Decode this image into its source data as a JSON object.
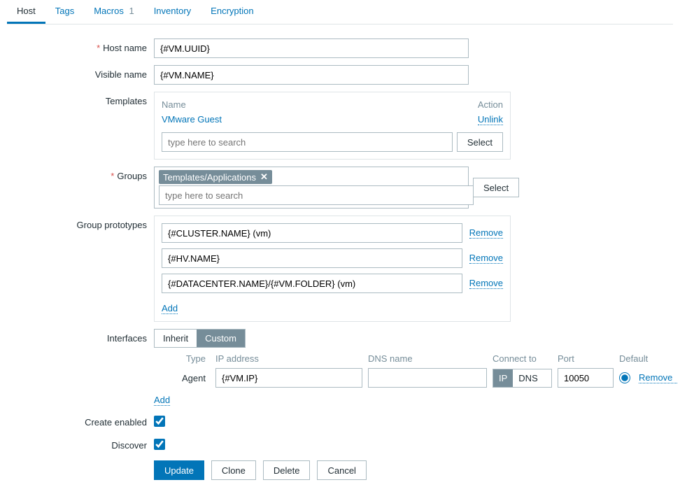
{
  "tabs": {
    "host": "Host",
    "tags": "Tags",
    "macros": "Macros",
    "macros_count": "1",
    "inventory": "Inventory",
    "encryption": "Encryption"
  },
  "labels": {
    "host_name": "Host name",
    "visible_name": "Visible name",
    "templates": "Templates",
    "groups": "Groups",
    "group_prototypes": "Group prototypes",
    "interfaces": "Interfaces",
    "create_enabled": "Create enabled",
    "discover": "Discover"
  },
  "fields": {
    "host_name": "{#VM.UUID}",
    "visible_name": "{#VM.NAME}"
  },
  "templates_header": {
    "name": "Name",
    "action": "Action"
  },
  "templates": [
    {
      "name": "VMware Guest",
      "action": "Unlink"
    }
  ],
  "search_placeholder": "type here to search",
  "select_label": "Select",
  "groups": {
    "chip": "Templates/Applications"
  },
  "group_prototypes": [
    {
      "value": "{#CLUSTER.NAME} (vm)"
    },
    {
      "value": "{#HV.NAME}"
    },
    {
      "value": "{#DATACENTER.NAME}/{#VM.FOLDER} (vm)"
    }
  ],
  "remove_label": "Remove",
  "add_label": "Add",
  "interfaces_toggle": {
    "inherit": "Inherit",
    "custom": "Custom"
  },
  "if_header": {
    "type": "Type",
    "ip": "IP address",
    "dns": "DNS name",
    "connect": "Connect to",
    "port": "Port",
    "default": "Default"
  },
  "if_row": {
    "type": "Agent",
    "ip": "{#VM.IP}",
    "dns": "",
    "connect_ip": "IP",
    "connect_dns": "DNS",
    "port": "10050"
  },
  "buttons": {
    "update": "Update",
    "clone": "Clone",
    "delete": "Delete",
    "cancel": "Cancel"
  }
}
